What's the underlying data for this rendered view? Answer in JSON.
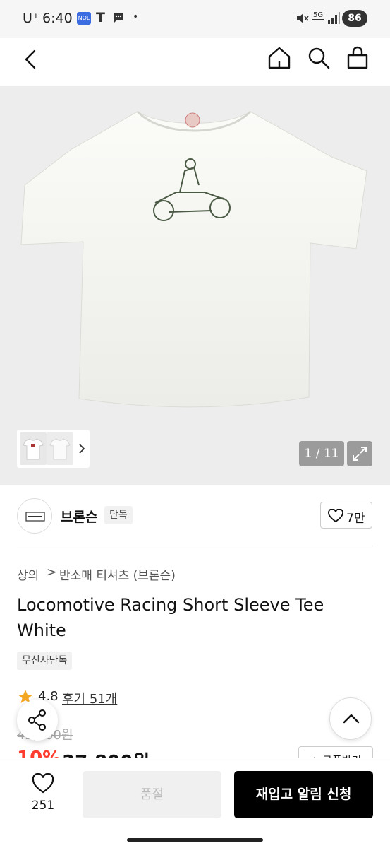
{
  "status_bar": {
    "carrier": "U⁺",
    "time": "6:40",
    "battery": "86",
    "network": "5G"
  },
  "nav": {
    "icons": [
      "back-arrow-icon",
      "home-icon",
      "search-icon",
      "cart-icon"
    ]
  },
  "gallery": {
    "counter": "1 / 11"
  },
  "brand": {
    "name": "브론슨",
    "exclusive_badge": "단독",
    "like_count": "7만"
  },
  "breadcrumb": {
    "level1": "상의",
    "separator": ">",
    "level2": "반소매 티셔츠 (브론슨)"
  },
  "product": {
    "title": "Locomotive Racing Short Sleeve Tee White",
    "tag": "무신사단독",
    "rating": "4.8",
    "reviews": "후기 51개",
    "original_price": "42,000원",
    "discount": "10%",
    "price": "37,800원",
    "coupon_button": "+ 쿠폰받기"
  },
  "bottom_bar": {
    "like_count": "251",
    "sold_out_label": "품절",
    "restock_label": "재입고 알림 신청"
  },
  "colors": {
    "discount": "#ff3d2e",
    "gallery_bg": "#ededed",
    "primary_button": "#000000"
  }
}
